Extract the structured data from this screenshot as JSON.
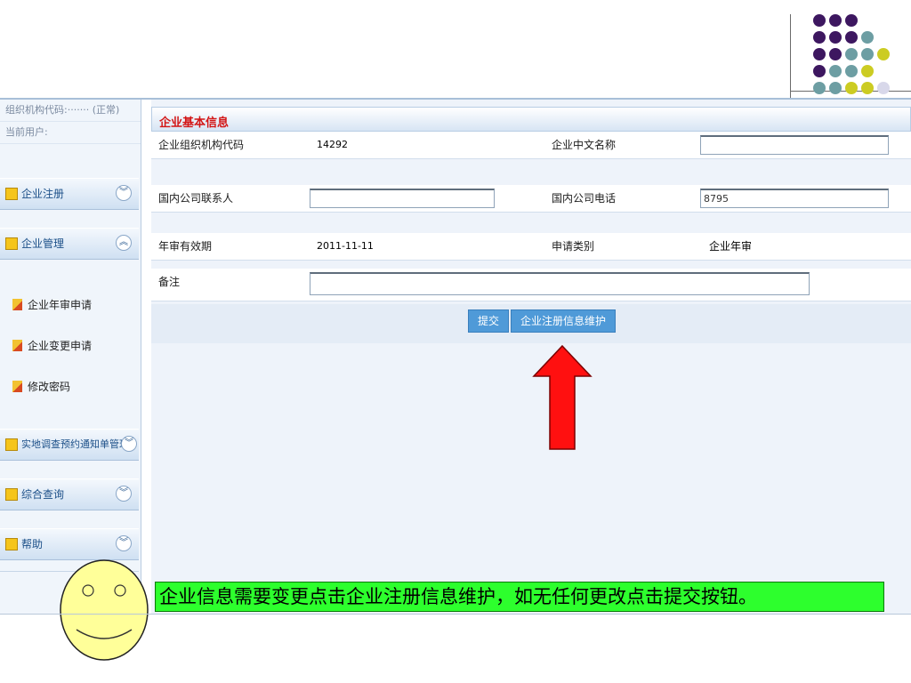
{
  "sidebar": {
    "org_code_label": "组织机构代码:",
    "org_code_value": "·······",
    "org_status": "(正常)",
    "current_user_label": "当前用户:",
    "groups": [
      {
        "label": "企业注册",
        "chevron": "︾"
      },
      {
        "label": "企业管理",
        "chevron": "︽"
      },
      {
        "label": "实地调查预约通知单管理",
        "chevron": "︾"
      },
      {
        "label": "综合查询",
        "chevron": "︾"
      },
      {
        "label": "帮助",
        "chevron": "︾"
      }
    ],
    "sub_items": [
      {
        "label": "企业年审申请"
      },
      {
        "label": "企业变更申请"
      },
      {
        "label": "修改密码"
      }
    ]
  },
  "form": {
    "title": "企业基本信息",
    "org_code_label": "企业组织机构代码",
    "org_code_value": "14292",
    "cn_name_label": "企业中文名称",
    "cn_name_value": "",
    "contact_label": "国内公司联系人",
    "contact_value": "",
    "phone_label": "国内公司电话",
    "phone_value": "8795",
    "valid_label": "年审有效期",
    "valid_value": "2011-11-11",
    "apply_type_label": "申请类别",
    "apply_type_value": "企业年审",
    "remark_label": "备注",
    "remark_value": ""
  },
  "buttons": {
    "submit": "提交",
    "maintain": "企业注册信息维护"
  },
  "callout": {
    "text": "企业信息需要变更点击企业注册信息维护，如无任何更改点击提交按钮。"
  },
  "colors": {
    "dot_purple": "#3d1760",
    "dot_teal": "#6d9ea3",
    "dot_yellow": "#cccc22",
    "dot_lavender": "#d8d8ea",
    "arrow_red": "#ff1010",
    "callout_green": "#2dff2d",
    "smiley_yellow": "#ffff99"
  }
}
